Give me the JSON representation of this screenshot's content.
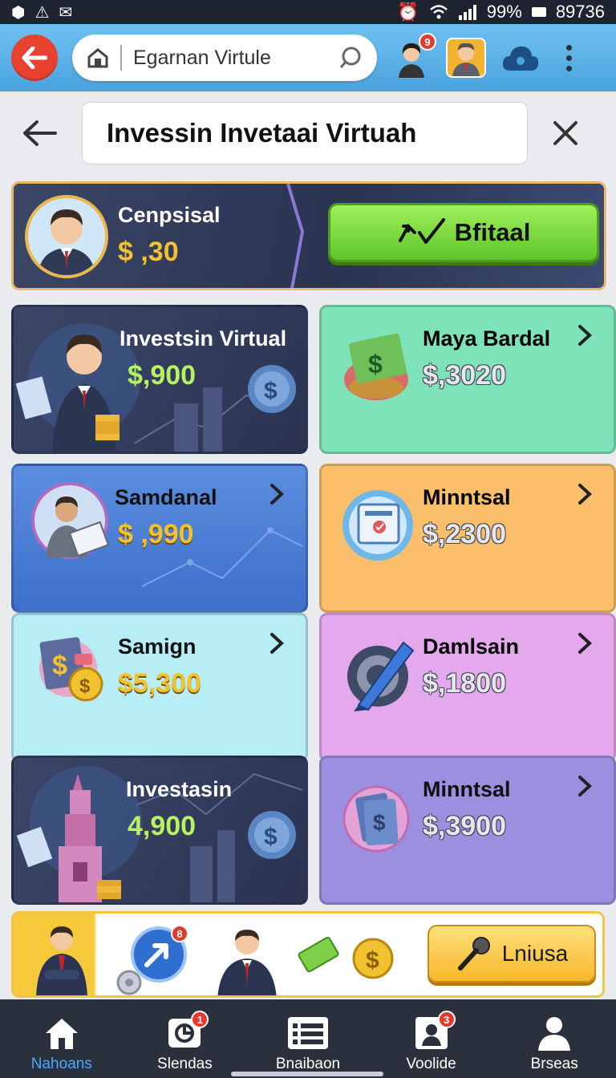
{
  "status_bar": {
    "battery_percent": "99%",
    "clock": "89736"
  },
  "browser": {
    "url_text": "Egarnan Virtule",
    "avatar_badge": "9"
  },
  "page": {
    "title": "Invessin Invetaai Virtuah"
  },
  "profile": {
    "name": "Cenpsisal",
    "amount": "$ ,30",
    "action_label": "Bfitaal"
  },
  "cards": [
    {
      "title": "Investsin Virtual",
      "amount": "$,900"
    },
    {
      "title": "Maya Bardal",
      "amount": "$,3020"
    },
    {
      "title": "Samdanal",
      "amount": "$ ,990"
    },
    {
      "title": "Minntsal",
      "amount": "$,2300"
    },
    {
      "title": "Samign",
      "amount": "$5,300"
    },
    {
      "title": "Damlsain",
      "amount": "$,1800"
    },
    {
      "title": "Investasin",
      "amount": "4,900"
    },
    {
      "title": "Minntsal",
      "amount": "$,3900"
    }
  ],
  "promo": {
    "share_badge": "8",
    "button_label": "Lniusa"
  },
  "bottom_nav": [
    {
      "label": "Nahoans",
      "badge": ""
    },
    {
      "label": "Slendas",
      "badge": "1"
    },
    {
      "label": "Bnaibaon",
      "badge": ""
    },
    {
      "label": "Voolide",
      "badge": "3"
    },
    {
      "label": "Brseas",
      "badge": ""
    }
  ],
  "colors": {
    "accent_blue": "#4aa3de",
    "active_nav": "#4aa8ff",
    "primary_green": "#5fc42a",
    "gold_amount": "#f1c22f"
  }
}
